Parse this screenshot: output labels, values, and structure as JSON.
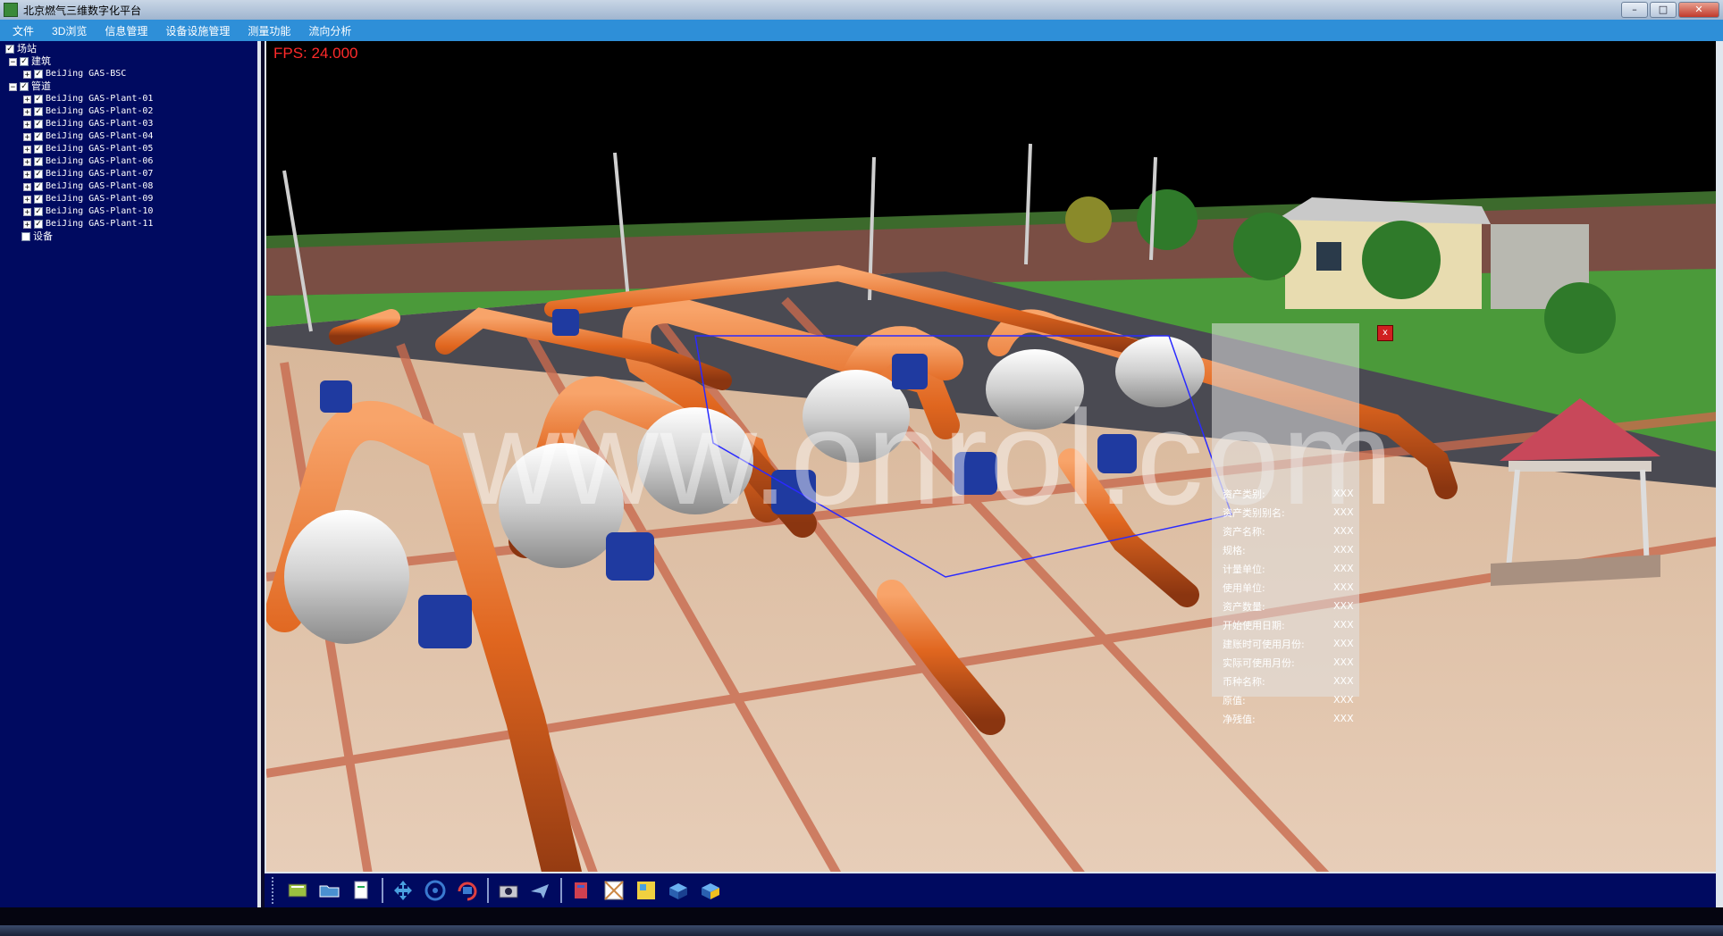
{
  "window": {
    "title": "北京燃气三维数字化平台",
    "minimize": "–",
    "maximize": "□",
    "close": "✕"
  },
  "menu": [
    "文件",
    "3D浏览",
    "信息管理",
    "设备设施管理",
    "测量功能",
    "流向分析"
  ],
  "tree": {
    "root": "场站",
    "building": {
      "label": "建筑",
      "items": [
        "BeiJing GAS-BSC"
      ]
    },
    "pipeline": {
      "label": "管道",
      "items": [
        "BeiJing GAS-Plant-01",
        "BeiJing GAS-Plant-02",
        "BeiJing GAS-Plant-03",
        "BeiJing GAS-Plant-04",
        "BeiJing GAS-Plant-05",
        "BeiJing GAS-Plant-06",
        "BeiJing GAS-Plant-07",
        "BeiJing GAS-Plant-08",
        "BeiJing GAS-Plant-09",
        "BeiJing GAS-Plant-10",
        "BeiJing GAS-Plant-11"
      ]
    },
    "equipment": "设备"
  },
  "viewport": {
    "fps": "FPS: 24.000",
    "watermark": "www.onrol.com"
  },
  "info_panel": {
    "close": "x",
    "rows": [
      {
        "k": "资产类别:",
        "v": "XXX"
      },
      {
        "k": "资产类别别名:",
        "v": "XXX"
      },
      {
        "k": "资产名称:",
        "v": "XXX"
      },
      {
        "k": "规格:",
        "v": "XXX"
      },
      {
        "k": "计量单位:",
        "v": "XXX"
      },
      {
        "k": "使用单位:",
        "v": "XXX"
      },
      {
        "k": "资产数量:",
        "v": "XXX"
      },
      {
        "k": "开始使用日期:",
        "v": "XXX"
      },
      {
        "k": "建账时可使用月份:",
        "v": "XXX"
      },
      {
        "k": "实际可使用月份:",
        "v": "XXX"
      },
      {
        "k": "币种名称:",
        "v": "XXX"
      },
      {
        "k": "原值:",
        "v": "XXX"
      },
      {
        "k": "净残值:",
        "v": "XXX"
      }
    ]
  },
  "toolbar": [
    "book-icon",
    "folder-open-icon",
    "document-icon",
    "pan-icon",
    "move-icon",
    "rotate-icon",
    "camera-icon",
    "fly-icon",
    "layer-icon",
    "measure-icon",
    "map-icon",
    "cube-blue-icon",
    "cube-yellow-icon"
  ],
  "colors": {
    "menu_bar": "#2e8fd8",
    "panel_bg": "#000a60",
    "pipe": "#e0661f",
    "valve": "#1f3aa0",
    "fps": "#ff2a2a"
  }
}
